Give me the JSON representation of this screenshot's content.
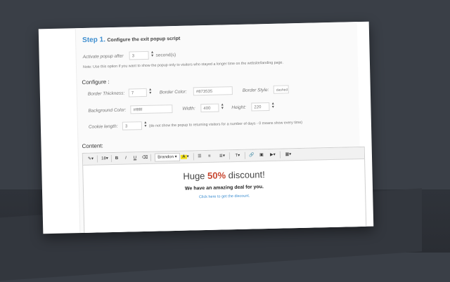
{
  "step": {
    "number": "Step 1.",
    "title": "Configure the exit popup script"
  },
  "activate": {
    "label": "Activate popup after",
    "value": "3",
    "unit": "second(s)"
  },
  "note": "Note: Use this option if you want to show the popup only to visitors who stayed a longer time on the website/landing page.",
  "configure": {
    "heading": "Configure :",
    "border_thickness": {
      "label": "Border Thickness:",
      "value": "7"
    },
    "border_color": {
      "label": "Border Color:",
      "value": "#873535"
    },
    "border_style": {
      "label": "Border Style:",
      "value": "dashed"
    },
    "background_color": {
      "label": "Background Color:",
      "value": "#ffffff"
    },
    "width": {
      "label": "Width:",
      "value": "400"
    },
    "height": {
      "label": "Height:",
      "value": "220"
    },
    "cookie_length": {
      "label": "Cookie length:",
      "value": "3",
      "hint": "(do not show the popup to returning visitors for a number of days - 0 means show every time)"
    }
  },
  "content": {
    "heading": "Content:",
    "toolbar": {
      "size": "18",
      "bold": "B",
      "italic": "I",
      "underline": "U",
      "font": "Brandon",
      "highlight": "A",
      "paragraph": "T"
    },
    "headline_before": "Huge ",
    "headline_percent": "50%",
    "headline_after": " discount!",
    "subline": "We have an amazing deal for you.",
    "link": "Click here to get the discount."
  },
  "colors": {
    "accent": "#3f8fd0",
    "percent": "#c8462f",
    "background": "#3a3f47"
  }
}
